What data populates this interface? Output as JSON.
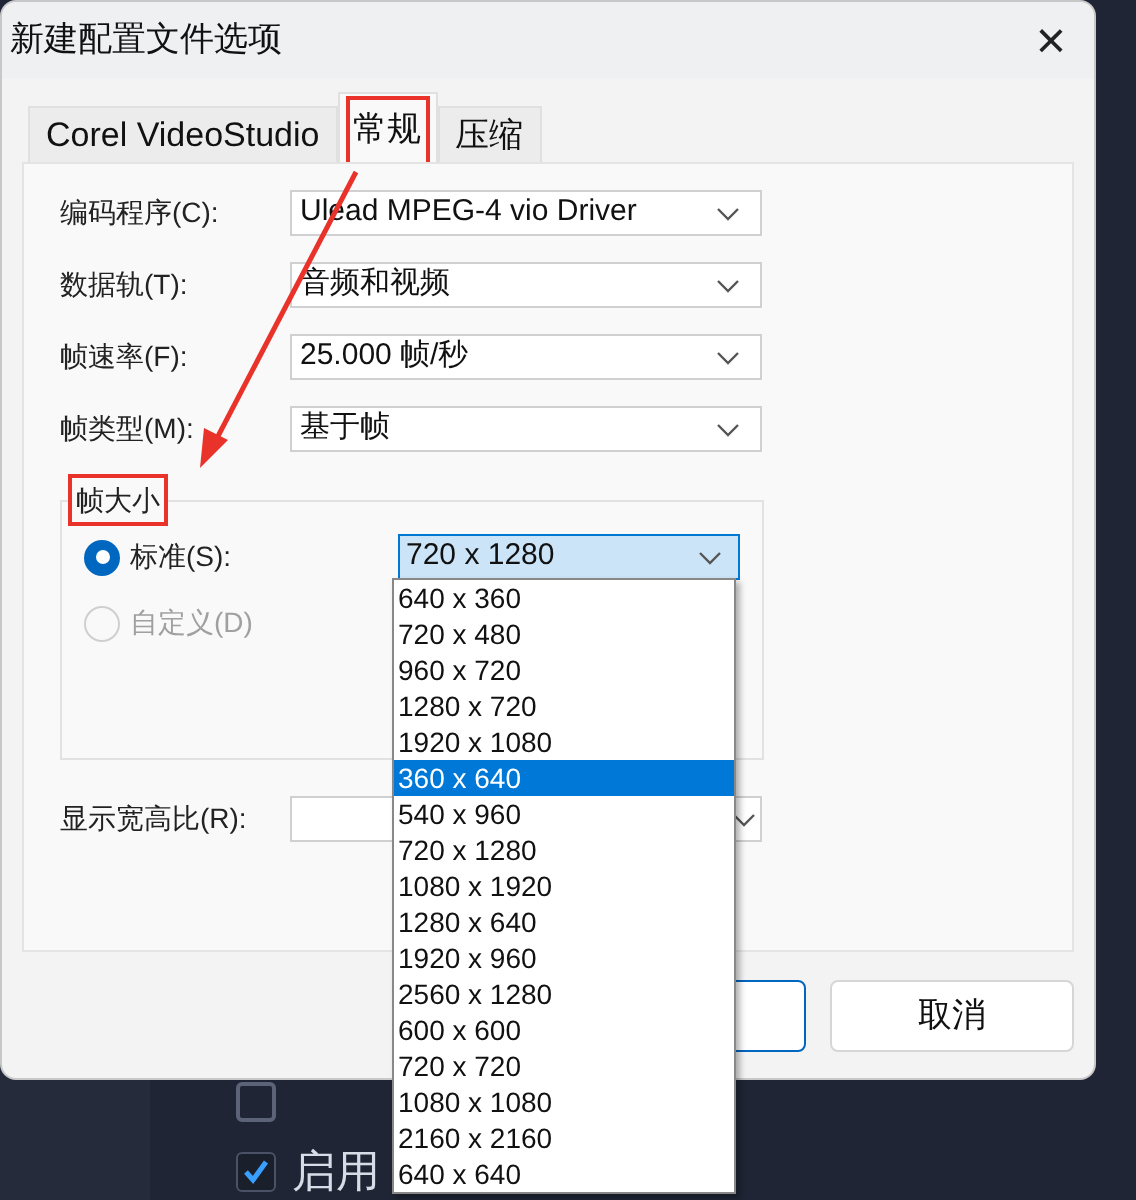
{
  "window": {
    "title": "新建配置文件选项",
    "close": "×"
  },
  "tabs": [
    {
      "label": "Corel VideoStudio",
      "selected": false
    },
    {
      "label": "常规",
      "selected": true
    },
    {
      "label": "压缩",
      "selected": false
    }
  ],
  "fields": [
    {
      "label": "编码程序(C):",
      "value": "Ulead MPEG-4 vio Driver"
    },
    {
      "label": "数据轨(T):",
      "value": "音频和视频"
    },
    {
      "label": "帧速率(F):",
      "value": "25.000 帧/秒"
    },
    {
      "label": "帧类型(M):",
      "value": "基于帧"
    }
  ],
  "frame_size": {
    "title": "帧大小",
    "options": [
      {
        "label": "标准(S):",
        "selected": true,
        "disabled": false
      },
      {
        "label": "自定义(D)",
        "selected": false,
        "disabled": true
      }
    ],
    "standard_value": "720 x 1280",
    "dropdown": [
      {
        "label": "640 x 360",
        "selected": false
      },
      {
        "label": "720 x 480",
        "selected": false
      },
      {
        "label": "960 x 720",
        "selected": false
      },
      {
        "label": "1280 x 720",
        "selected": false
      },
      {
        "label": "1920 x 1080",
        "selected": false
      },
      {
        "label": "360 x 640",
        "selected": true
      },
      {
        "label": "540 x 960",
        "selected": false
      },
      {
        "label": "720 x 1280",
        "selected": false
      },
      {
        "label": "1080 x 1920",
        "selected": false
      },
      {
        "label": "1280 x 640",
        "selected": false
      },
      {
        "label": "1920 x 960",
        "selected": false
      },
      {
        "label": "2560 x 1280",
        "selected": false
      },
      {
        "label": "600 x 600",
        "selected": false
      },
      {
        "label": "720 x 720",
        "selected": false
      },
      {
        "label": "1080 x 1080",
        "selected": false
      },
      {
        "label": "2160 x 2160",
        "selected": false
      },
      {
        "label": "640 x 640",
        "selected": false
      }
    ]
  },
  "aspect": {
    "label": "显示宽高比(R):"
  },
  "buttons": [
    {
      "default": true
    },
    {
      "label": "取消",
      "default": false
    }
  ],
  "background_options": [
    {
      "checked": false
    },
    {
      "label": "启用",
      "checked": true
    }
  ]
}
